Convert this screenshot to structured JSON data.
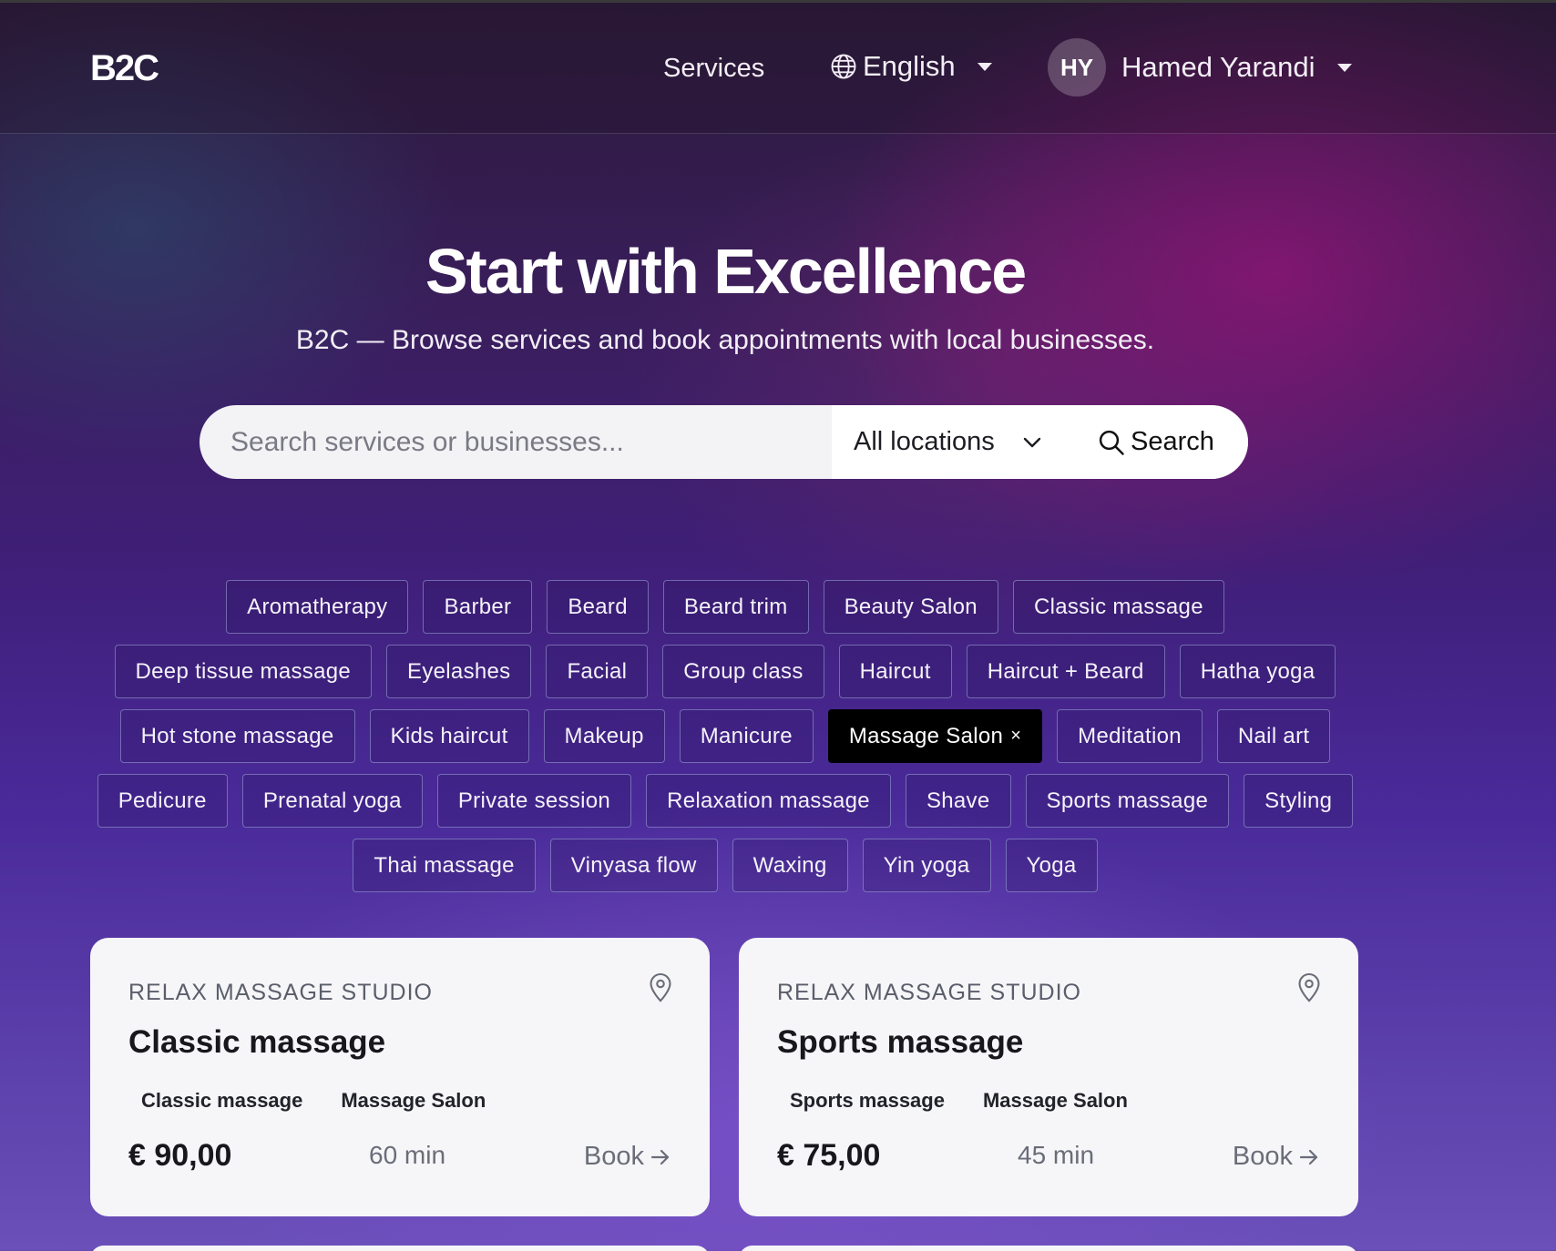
{
  "nav": {
    "logo": "B2C",
    "services_label": "Services",
    "language": {
      "label": "English",
      "icon": "globe-icon"
    },
    "user": {
      "initials": "HY",
      "name": "Hamed Yarandi"
    }
  },
  "hero": {
    "title": "Start with Excellence",
    "subtitle": "B2C — Browse services and book appointments with local businesses."
  },
  "search": {
    "placeholder": "Search services or businesses...",
    "value": "",
    "location": "All locations",
    "button_label": "Search"
  },
  "tags": {
    "rows": [
      [
        "Aromatherapy",
        "Barber",
        "Beard",
        "Beard trim",
        "Beauty Salon",
        "Classic massage"
      ],
      [
        "Deep tissue massage",
        "Eyelashes",
        "Facial",
        "Group class",
        "Haircut",
        "Haircut + Beard",
        "Hatha yoga"
      ],
      [
        "Hot stone massage",
        "Kids haircut",
        "Makeup",
        "Manicure",
        "Massage Salon",
        "Meditation",
        "Nail art"
      ],
      [
        "Pedicure",
        "Prenatal yoga",
        "Private session",
        "Relaxation massage",
        "Shave",
        "Sports massage",
        "Styling"
      ],
      [
        "Thai massage",
        "Vinyasa flow",
        "Waxing",
        "Yin yoga",
        "Yoga"
      ]
    ],
    "active": "Massage Salon",
    "remove_glyph": "×"
  },
  "cards": [
    {
      "business": "RELAX MASSAGE STUDIO",
      "service": "Classic massage",
      "category": "Classic massage",
      "type": "Massage Salon",
      "price": "€ 90,00",
      "duration": "60 min",
      "book_label": "Book"
    },
    {
      "business": "RELAX MASSAGE STUDIO",
      "service": "Sports massage",
      "category": "Sports massage",
      "type": "Massage Salon",
      "price": "€ 75,00",
      "duration": "45 min",
      "book_label": "Book"
    }
  ]
}
